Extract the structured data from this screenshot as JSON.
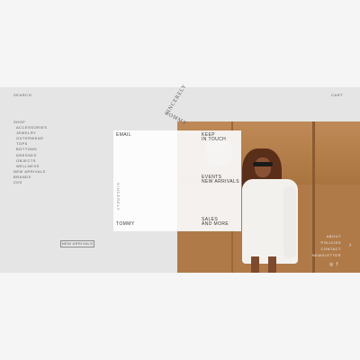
{
  "header": {
    "search_label": "SEARCH",
    "cart_label": "CART",
    "logo_top": "SINCERELY",
    "logo_bottom": "TOMMY"
  },
  "menu": {
    "shop": "SHOP",
    "items": [
      "ACCESSORIES",
      "JEWELRY",
      "OUTERWEAR",
      "TOPS",
      "BOTTOMS",
      "DRESSES",
      "OBJECTS",
      "WELLNESS"
    ],
    "new_arrivals": "NEW ARRIVALS",
    "brands": "BRANDS",
    "cks": "CKS"
  },
  "buttons": {
    "new_arrivals": "NEW ARRIVALS"
  },
  "overlay": {
    "email_label": "EMAIL",
    "keep_line1": "KEEP",
    "keep_line2": "IN TOUCH",
    "events_line1": "EVENTS",
    "events_line2": "NEW ARRIVALS",
    "sales_line1": "SALES",
    "sales_line2": "AND MORE",
    "brand": "TOMMY"
  },
  "footer": {
    "links": [
      "ABOUT",
      "POLICIES",
      "CONTACT",
      "NEWSLETTER"
    ],
    "icons": [
      "instagram-icon",
      "facebook-icon"
    ],
    "arrow_icon": "chevron-right-icon"
  },
  "colors": {
    "page_bg": "#f5f5f5",
    "site_bg": "#e5e5e5",
    "photo_wood": "#b07a48"
  }
}
